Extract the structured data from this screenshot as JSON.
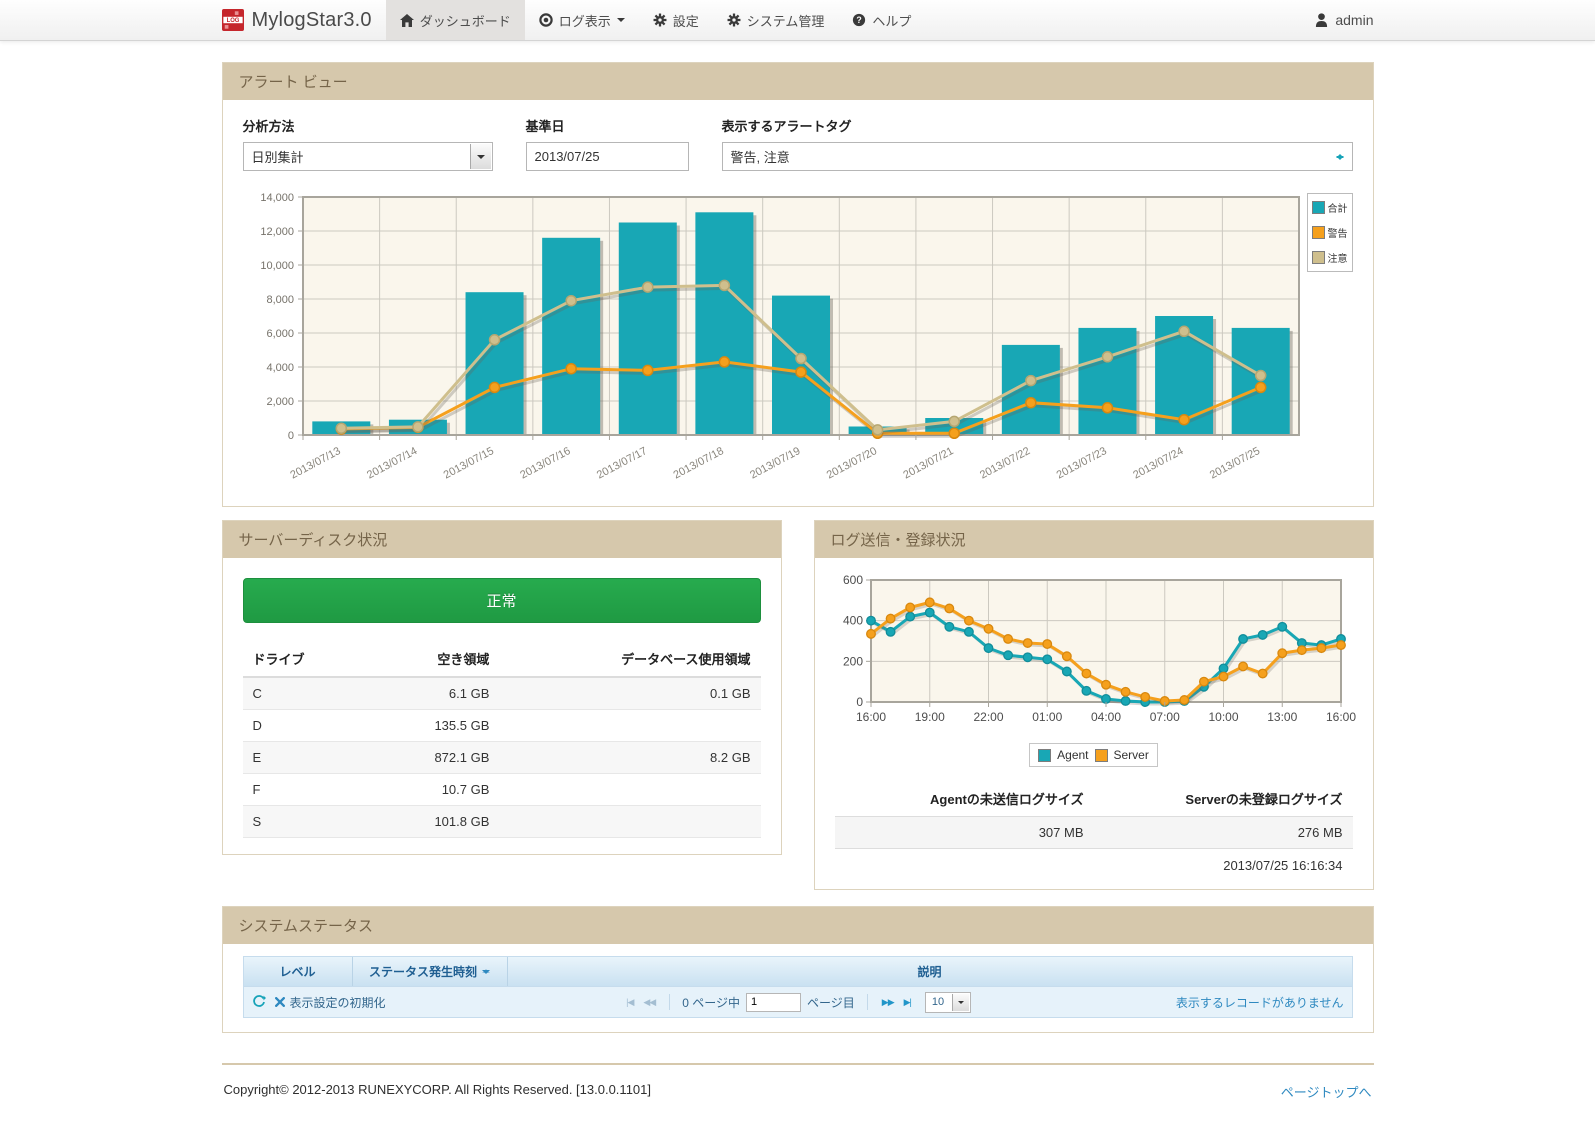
{
  "navbar": {
    "brand": "MylogStar3.0",
    "items": [
      {
        "label": "ダッシュボード",
        "icon": "home-icon",
        "active": true
      },
      {
        "label": "ログ表示",
        "icon": "eye-icon",
        "has_dropdown": true
      },
      {
        "label": "設定",
        "icon": "gear-icon"
      },
      {
        "label": "システム管理",
        "icon": "gear-icon"
      },
      {
        "label": "ヘルプ",
        "icon": "help-icon"
      }
    ],
    "user": "admin"
  },
  "alert_panel": {
    "title": "アラート ビュー",
    "form": {
      "analysis_label": "分析方法",
      "analysis_value": "日別集計",
      "date_label": "基準日",
      "date_value": "2013/07/25",
      "tag_label": "表示するアラートタグ",
      "tag_value": "警告, 注意"
    }
  },
  "disk_panel": {
    "title": "サーバーディスク状況",
    "status": "正常",
    "status_color": "#23a449",
    "table": {
      "headers": [
        "ドライブ",
        "空き領域",
        "データベース使用領域"
      ],
      "rows": [
        [
          "C",
          "6.1 GB",
          "0.1 GB"
        ],
        [
          "D",
          "135.5 GB",
          ""
        ],
        [
          "E",
          "872.1 GB",
          "8.2 GB"
        ],
        [
          "F",
          "10.7 GB",
          ""
        ],
        [
          "S",
          "101.8 GB",
          ""
        ]
      ]
    }
  },
  "log_panel": {
    "title": "ログ送信・登録状況",
    "table": {
      "headers": [
        "Agentの未送信ログサイズ",
        "Serverの未登録ログサイズ"
      ],
      "values": [
        "307 MB",
        "276 MB"
      ]
    },
    "timestamp": "2013/07/25 16:16:34"
  },
  "status_panel": {
    "title": "システムステータス",
    "columns": [
      "レベル",
      "ステータス発生時刻",
      "説明"
    ],
    "pager": {
      "reset_label": "表示設定の初期化",
      "page_prefix": "0 ページ中",
      "page_value": "1",
      "page_suffix": "ページ目",
      "page_size": "10",
      "empty_text": "表示するレコードがありません",
      "icons": {
        "first": "|◀",
        "prev": "◀◀",
        "next": "▶▶",
        "last": "▶|"
      }
    }
  },
  "footer": {
    "copyright": "Copyright© 2012-2013 RUNEXYCORP. All Rights Reserved. [13.0.0.1101]",
    "top_link": "ページトップへ"
  },
  "chart_data": [
    {
      "type": "bar",
      "title": "アラート ビュー",
      "categories": [
        "2013/07/13",
        "2013/07/14",
        "2013/07/15",
        "2013/07/16",
        "2013/07/17",
        "2013/07/18",
        "2013/07/19",
        "2013/07/20",
        "2013/07/21",
        "2013/07/22",
        "2013/07/23",
        "2013/07/24",
        "2013/07/25"
      ],
      "series": [
        {
          "name": "合計",
          "type": "bar",
          "color": "#18a7b5",
          "values": [
            800,
            900,
            8400,
            11600,
            12500,
            13100,
            8200,
            500,
            1000,
            5300,
            6300,
            7000,
            6300
          ]
        },
        {
          "name": "警告",
          "type": "line",
          "color": "#f5a01d",
          "marker_stroke": "#d8880f",
          "values": [
            350,
            450,
            2800,
            3900,
            3800,
            4300,
            3700,
            100,
            100,
            1900,
            1600,
            900,
            2800
          ]
        },
        {
          "name": "注意",
          "type": "line",
          "color": "#cfbf8d",
          "marker_stroke": "#b5a671",
          "values": [
            400,
            480,
            5600,
            7900,
            8700,
            8800,
            4500,
            300,
            800,
            3200,
            4600,
            6100,
            3500
          ]
        }
      ],
      "ylim": [
        0,
        14000
      ],
      "ytick": 2000,
      "grid": true,
      "legend_position": "right",
      "plot_bg": "#faf6ec"
    },
    {
      "type": "line",
      "title": "ログ送信・登録状況",
      "x_labels": [
        "16:00",
        "19:00",
        "22:00",
        "01:00",
        "04:00",
        "07:00",
        "10:00",
        "13:00",
        "16:00"
      ],
      "x_label_every": 3,
      "series": [
        {
          "name": "Agent",
          "color": "#18a7b5",
          "marker_stroke": "#128d9a",
          "values": [
            400,
            345,
            420,
            440,
            370,
            345,
            265,
            230,
            220,
            210,
            150,
            55,
            15,
            5,
            0,
            0,
            5,
            75,
            165,
            310,
            330,
            370,
            290,
            280,
            310
          ]
        },
        {
          "name": "Server",
          "color": "#f5a01d",
          "marker_stroke": "#d8880f",
          "values": [
            335,
            410,
            465,
            490,
            460,
            400,
            360,
            310,
            290,
            285,
            225,
            140,
            85,
            50,
            25,
            5,
            10,
            100,
            125,
            175,
            140,
            240,
            255,
            265,
            280
          ]
        }
      ],
      "ylim": [
        0,
        600
      ],
      "ytick": 200,
      "grid": true,
      "legend_position": "bottom",
      "plot_bg": "#faf6ec"
    }
  ]
}
